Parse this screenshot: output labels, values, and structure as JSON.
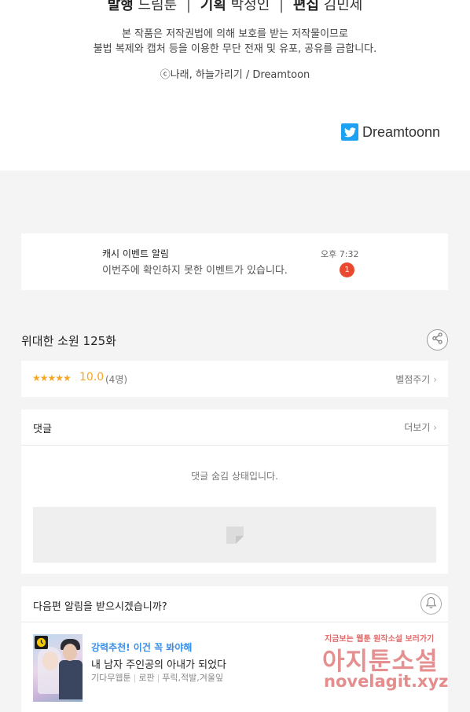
{
  "credits": {
    "publish_label": "발행",
    "publish_value": "드림툰",
    "plan_label": "기획",
    "plan_value": "박정인",
    "edit_label": "편집",
    "edit_value": "김민제",
    "notice_line1": "본 작품은 저작권법에 의해 보호를 받는 저작물이므로",
    "notice_line2": "불법 복제와 캡처 등을 이용한 무단 전재 및 유포, 공유를 금합니다.",
    "copyright": "ⓒ나래, 하늘가리기 / Dreamtoon",
    "twitter_handle": "Dreamtoonn"
  },
  "notification": {
    "title": "캐시 이벤트 알림",
    "message": "이번주에 확인하지 못한 이벤트가 있습니다.",
    "time": "오후 7:32",
    "badge_count": "1"
  },
  "episode": {
    "title": "위대한 소원 125화"
  },
  "rating": {
    "stars": "★★★★★",
    "score": "10.0",
    "count": "(4명)",
    "rate_link": "별점주기"
  },
  "comments": {
    "title": "댓글",
    "more": "더보기",
    "hidden_notice": "댓글 숨김 상태입니다."
  },
  "next_alert": {
    "question": "다음편 알림을 받으시겠습니까?"
  },
  "recommendation": {
    "label": "강력추천! 이건 꼭 봐야해",
    "title": "내 남자 주인공의 아내가 되었다",
    "tags": [
      "기다무웹툰",
      "로판",
      "푸릭,적발,겨울잎"
    ]
  },
  "watermark": {
    "top": "지금보는 웹툰 원작소설 보러가기",
    "main": "아지툰소설",
    "url": "novelagit.xyz"
  },
  "colors": {
    "accent_orange": "#f5a623",
    "badge_red": "#e8492f",
    "link_blue": "#3a8ee6",
    "twitter_blue": "#1da1f2"
  },
  "icons": {
    "share": "share-icon",
    "bell": "bell-icon",
    "twitter": "twitter-icon",
    "clock": "clock-icon"
  }
}
